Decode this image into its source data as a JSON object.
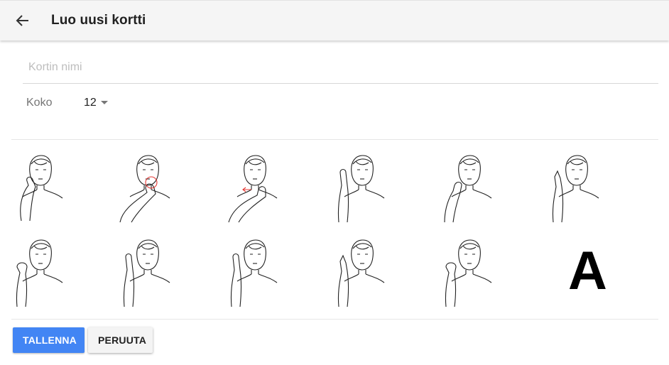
{
  "header": {
    "title": "Luo uusi kortti",
    "back_icon": "arrow-back-icon"
  },
  "form": {
    "name_placeholder": "Kortin nimi",
    "name_value": "",
    "size_label": "Koko",
    "size_value": "12"
  },
  "signs": [
    {
      "icon": "sign-figure-icon",
      "hand": "low"
    },
    {
      "icon": "sign-figure-icon",
      "hand": "cheek"
    },
    {
      "icon": "sign-figure-icon",
      "hand": "mouth"
    },
    {
      "icon": "sign-figure-icon",
      "hand": "up"
    },
    {
      "icon": "sign-figure-icon",
      "hand": "chin"
    },
    {
      "icon": "sign-figure-icon",
      "hand": "point"
    },
    {
      "icon": "sign-figure-icon",
      "hand": "fist"
    },
    {
      "icon": "sign-figure-icon",
      "hand": "up"
    },
    {
      "icon": "sign-figure-icon",
      "hand": "up"
    },
    {
      "icon": "sign-figure-icon",
      "hand": "point"
    },
    {
      "icon": "sign-figure-icon",
      "hand": "fist"
    },
    {
      "letter": "A"
    }
  ],
  "buttons": {
    "save_label": "TALLENNA",
    "cancel_label": "PERUUTA"
  },
  "colors": {
    "primary": "#4285f4",
    "appbar": "#f5f5f5",
    "accent_red": "#e53935"
  }
}
